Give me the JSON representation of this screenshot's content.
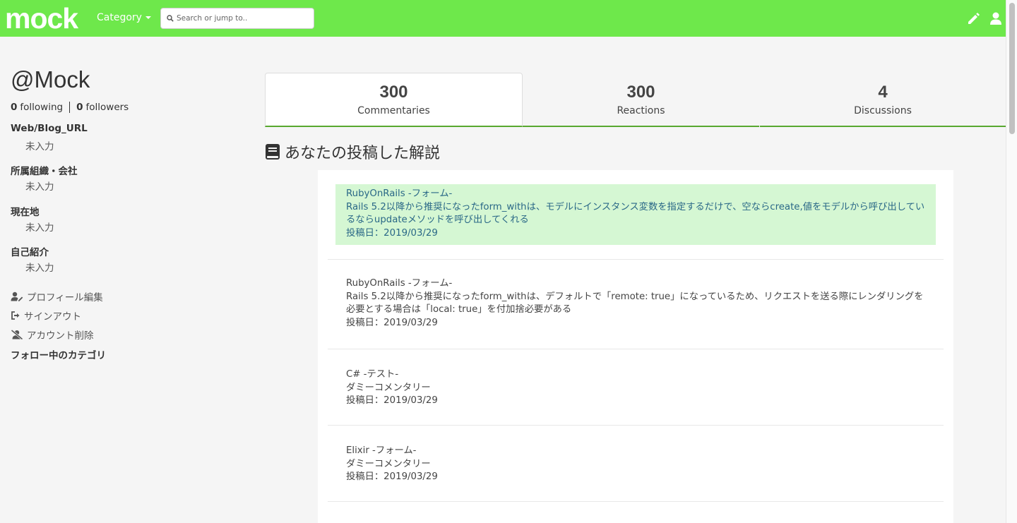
{
  "header": {
    "logo": "mock",
    "category_label": "Category",
    "search_placeholder": "Search or jump to..",
    "colors": {
      "navbar": "#6ee84b",
      "accent_line": "#58a82f"
    }
  },
  "profile": {
    "username": "@Mock",
    "following_count": "0",
    "following_label": "following",
    "followers_count": "0",
    "followers_label": "followers",
    "fields": [
      {
        "label": "Web/Blog_URL",
        "value": "未入力"
      },
      {
        "label": "所属組織・会社",
        "value": "未入力"
      },
      {
        "label": "現在地",
        "value": "未入力"
      },
      {
        "label": "自己紹介",
        "value": "未入力"
      }
    ],
    "actions": {
      "edit_profile": "プロフィール編集",
      "sign_out": "サインアウト",
      "delete_account": "アカウント削除"
    },
    "following_categories_label": "フォロー中のカテゴリ"
  },
  "tabs": [
    {
      "count": "300",
      "label": "Commentaries"
    },
    {
      "count": "300",
      "label": "Reactions"
    },
    {
      "count": "4",
      "label": "Discussions"
    }
  ],
  "section_title": "あなたの投稿した解説",
  "commentaries": [
    {
      "title": "RubyOnRails -フォーム-",
      "body": "Rails 5.2以降から推奨になったform_withは、モデルにインスタンス変数を指定するだけで、空ならcreate,値をモデルから呼び出しているならupdateメソッドを呼び出してくれる",
      "date": "投稿日：2019/03/29"
    },
    {
      "title": "RubyOnRails -フォーム-",
      "body": "Rails 5.2以降から推奨になったform_withは、デフォルトで「remote: true」になっているため、リクエストを送る際にレンダリングを必要とする場合は「local: true」を付加捨必要がある",
      "date": "投稿日：2019/03/29"
    },
    {
      "title": "C# -テスト-",
      "body": "ダミーコメンタリー",
      "date": "投稿日：2019/03/29"
    },
    {
      "title": "Elixir -フォーム-",
      "body": "ダミーコメンタリー",
      "date": "投稿日：2019/03/29"
    }
  ]
}
